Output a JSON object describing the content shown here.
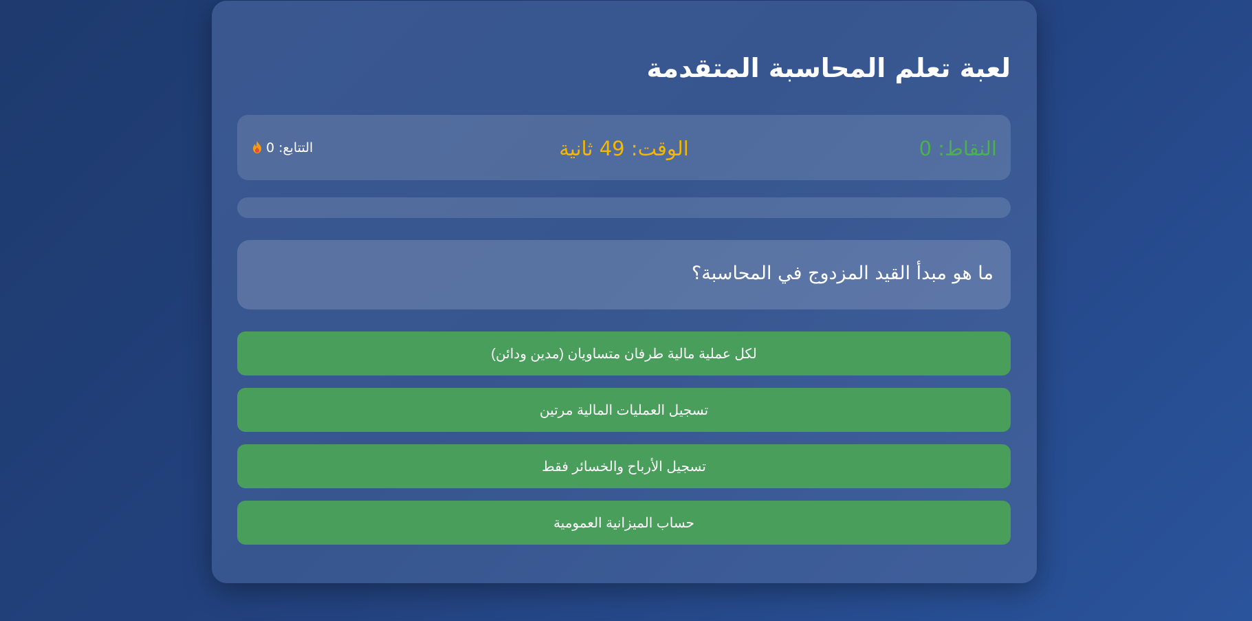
{
  "game": {
    "title": "لعبة تعلم المحاسبة المتقدمة"
  },
  "stats": {
    "score": "النقاط: 0",
    "timer": "الوقت: 49 ثانية",
    "streak": "التتابع: 0",
    "streak_icon": "fire-icon"
  },
  "progress": {
    "value_percent": 0
  },
  "question": {
    "text": "ما هو مبدأ القيد المزدوج في المحاسبة؟"
  },
  "answers": [
    {
      "label": "لكل عملية مالية طرفان متساويان (مدين ودائن)"
    },
    {
      "label": "تسجيل العمليات المالية مرتين"
    },
    {
      "label": "تسجيل الأرباح والخسائر فقط"
    },
    {
      "label": "حساب الميزانية العمومية"
    }
  ],
  "colors": {
    "score": "#4caf50",
    "timer": "#f5b700",
    "answer_button": "#4a9e5c"
  }
}
